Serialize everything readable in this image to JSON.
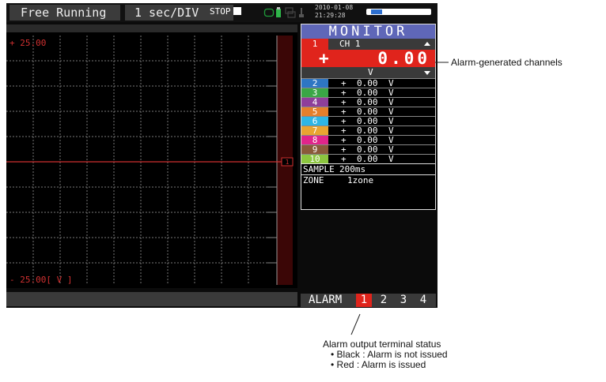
{
  "topbar": {
    "mode": "Free Running",
    "time_div": "1  sec/DIV",
    "stop": "STOP",
    "date": "2010-01-08",
    "time": "21:29:28",
    "battery_level": 0.2
  },
  "chart": {
    "ytop": "+ 25.00",
    "ybottom": "- 25.00[ V ]",
    "channel_marker": "1"
  },
  "monitor": {
    "title": "MONITOR",
    "ch1": {
      "num": "1",
      "name": "CH 1",
      "sign": "+",
      "value": "0.00",
      "unit": "V",
      "color": "#e0241c"
    },
    "channels": [
      {
        "num": "2",
        "sign": "+",
        "value": "0.00",
        "unit": "V",
        "color": "#2e76c3"
      },
      {
        "num": "3",
        "sign": "+",
        "value": "0.00",
        "unit": "V",
        "color": "#3aa646"
      },
      {
        "num": "4",
        "sign": "+",
        "value": "0.00",
        "unit": "V",
        "color": "#8e3f9a"
      },
      {
        "num": "5",
        "sign": "+",
        "value": "0.00",
        "unit": "V",
        "color": "#e57f2b"
      },
      {
        "num": "6",
        "sign": "+",
        "value": "0.00",
        "unit": "V",
        "color": "#2fb6e4"
      },
      {
        "num": "7",
        "sign": "+",
        "value": "0.00",
        "unit": "V",
        "color": "#e9a531"
      },
      {
        "num": "8",
        "sign": "+",
        "value": "0.00",
        "unit": "V",
        "color": "#e0258a"
      },
      {
        "num": "9",
        "sign": "+",
        "value": "0.00",
        "unit": "V",
        "color": "#8a5a3a"
      },
      {
        "num": "10",
        "sign": "+",
        "value": "0.00",
        "unit": "V",
        "color": "#8cc63f"
      }
    ],
    "sample_label": "SAMPLE",
    "sample_value": "200ms",
    "zone_label": "ZONE",
    "zone_value": "1zone"
  },
  "alarm": {
    "label": "ALARM",
    "terminals": [
      {
        "num": "1",
        "issued": true
      },
      {
        "num": "2",
        "issued": false
      },
      {
        "num": "3",
        "issued": false
      },
      {
        "num": "4",
        "issued": false
      }
    ]
  },
  "annotations": {
    "alarm_channels": "Alarm-generated channels",
    "terminal_title": "Alarm output terminal status",
    "terminal_black": "• Black : Alarm is not issued",
    "terminal_red": "• Red : Alarm is issued"
  },
  "colors": {
    "alarm_red": "#e0241c",
    "monitor_title": "#5f67b8"
  }
}
